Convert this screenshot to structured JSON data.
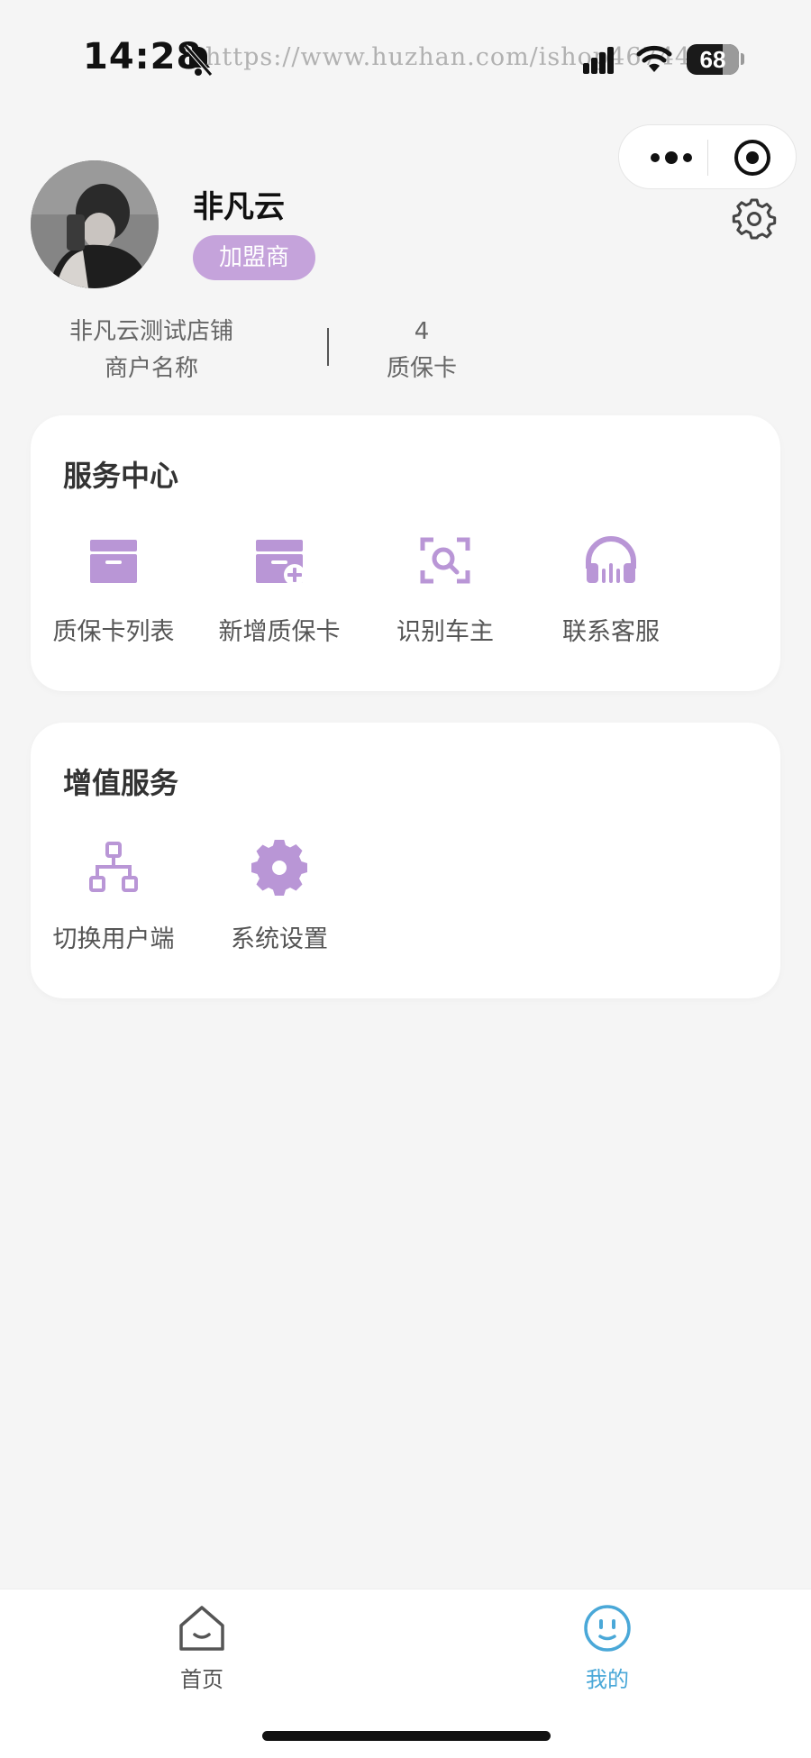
{
  "status_bar": {
    "time": "14:28",
    "watermark": "https://www.huzhan.com/ishop46744",
    "battery": "68",
    "icons": [
      "bell-off-icon",
      "signal-icon",
      "wifi-icon",
      "battery-icon"
    ]
  },
  "capsule": {
    "icons": [
      "more-icon",
      "target-icon"
    ]
  },
  "profile": {
    "name": "非凡云",
    "role": "加盟商",
    "shop_value": "非凡云测试店铺",
    "shop_label": "商户名称",
    "card_count": "4",
    "card_label": "质保卡"
  },
  "service_center": {
    "title": "服务中心",
    "items": [
      {
        "label": "质保卡列表",
        "icon": "card-box-icon"
      },
      {
        "label": "新增质保卡",
        "icon": "card-add-icon"
      },
      {
        "label": "识别车主",
        "icon": "scan-search-icon"
      },
      {
        "label": "联系客服",
        "icon": "headset-icon"
      }
    ]
  },
  "value_services": {
    "title": "增值服务",
    "items": [
      {
        "label": "切换用户端",
        "icon": "org-chart-icon"
      },
      {
        "label": "系统设置",
        "icon": "gear-icon"
      }
    ]
  },
  "tabbar": {
    "tabs": [
      {
        "label": "首页",
        "icon": "home-icon"
      },
      {
        "label": "我的",
        "icon": "face-icon",
        "active": true
      }
    ]
  },
  "colors": {
    "accent": "#c5a3db",
    "icon": "#b996d6",
    "active_tab": "#4aa8d8",
    "background": "#f5f5f5"
  }
}
